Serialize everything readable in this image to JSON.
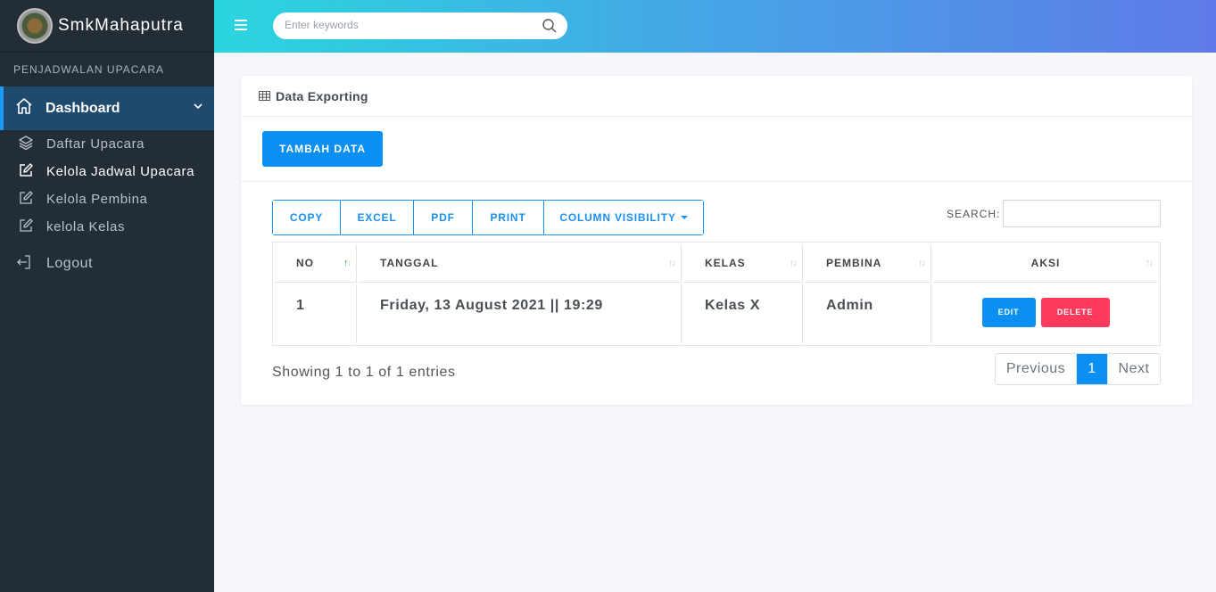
{
  "brand": {
    "name": "SmkMahaputra"
  },
  "sidebar": {
    "section_title": "PENJADWALAN UPACARA",
    "main_item": {
      "label": "Dashboard",
      "icon": "home-icon"
    },
    "items": [
      {
        "label": "Daftar Upacara",
        "icon": "layers-icon"
      },
      {
        "label": "Kelola Jadwal Upacara",
        "icon": "edit-icon"
      },
      {
        "label": "Kelola Pembina",
        "icon": "edit-icon"
      },
      {
        "label": "kelola Kelas",
        "icon": "edit-icon"
      }
    ],
    "logout": {
      "label": "Logout",
      "icon": "logout-icon"
    }
  },
  "topbar": {
    "search_placeholder": "Enter keywords"
  },
  "card": {
    "title": "Data Exporting",
    "add_button": "TAMBAH DATA",
    "export_buttons": {
      "copy": "COPY",
      "excel": "EXCEL",
      "pdf": "PDF",
      "print": "PRINT",
      "colvis": "COLUMN VISIBILITY"
    },
    "search_label": "SEARCH:",
    "table": {
      "headers": {
        "no": "NO",
        "tanggal": "TANGGAL",
        "kelas": "KELAS",
        "pembina": "PEMBINA",
        "aksi": "AKSI"
      },
      "rows": [
        {
          "no": "1",
          "tanggal": "Friday, 13 August 2021 || 19:29",
          "kelas": "Kelas X",
          "pembina": "Admin",
          "edit": "EDIT",
          "delete": "DELETE"
        }
      ]
    },
    "info": "Showing 1 to 1 of 1 entries",
    "pagination": {
      "previous": "Previous",
      "current": "1",
      "next": "Next"
    }
  },
  "colors": {
    "sidebar_bg": "#222d36",
    "accent": "#0c8ff2",
    "danger": "#fd3a5c",
    "active_nav": "#1e4a6e"
  }
}
